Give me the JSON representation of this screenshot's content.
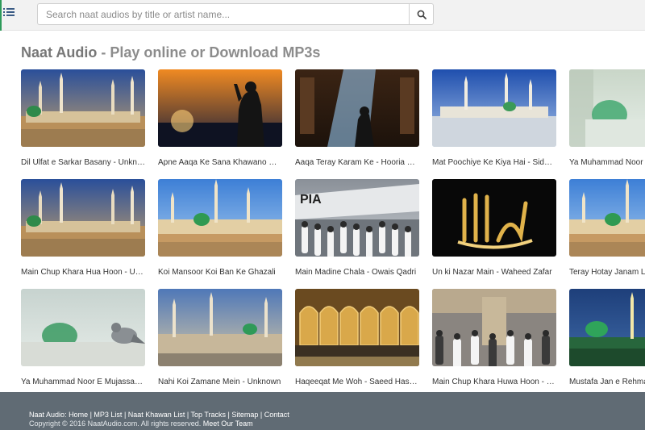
{
  "header": {
    "menu_icon": "sidebar-toggle-icon",
    "search": {
      "placeholder": "Search naat audios by title or artist name...",
      "value": ""
    },
    "search_icon": "search-icon"
  },
  "page": {
    "title_brand": "Naat Audio",
    "title_rest": " - Play online or Download MP3s"
  },
  "tracks": [
    {
      "title": "Dil Ulfat e Sarkar Basany - Unknown",
      "thumb": "mosque-madinah"
    },
    {
      "title": "Apne Aaqa Ke Sana Khawano Ki Mehfil",
      "thumb": "praying-sunset"
    },
    {
      "title": "Aaqa Teray Karam Ke - Hooria Faheem",
      "thumb": "praying-light"
    },
    {
      "title": "Mat Poochiye Ke Kiya Hai - Siddique Ismail",
      "thumb": "mosque-plaza"
    },
    {
      "title": "Ya Muhammad Noor E Mujassam",
      "thumb": "green-dome-blur"
    },
    {
      "title": "Main Chup Khara Hua Hoon - Unknown",
      "thumb": "mosque-madinah"
    },
    {
      "title": "Koi Mansoor Koi Ban Ke Ghazali",
      "thumb": "mosque-blue-sky"
    },
    {
      "title": "Main Madine Chala - Owais Qadri",
      "thumb": "pilgrims-airplane"
    },
    {
      "title": "Un ki Nazar Main - Waheed Zafar",
      "thumb": "allah-calligraphy"
    },
    {
      "title": "Teray Hotay Janam Liya",
      "thumb": "mosque-blue-sky"
    },
    {
      "title": "Ya Muhammad Noor E Mujassam - Unknown",
      "thumb": "dome-pigeon"
    },
    {
      "title": "Nahi Koi Zamane Mein - Unknown",
      "thumb": "mosque-evening"
    },
    {
      "title": "Haqeeqat Me Woh - Saeed Hashmi",
      "thumb": "mosque-interior"
    },
    {
      "title": "Main Chup Khara Huwa Hoon - Unknown",
      "thumb": "pilgrims-interior"
    },
    {
      "title": "Mustafa Jan e Rehmat",
      "thumb": "green-dome-night"
    }
  ],
  "footer": {
    "brand": "Naat Audio:",
    "links": [
      "Home",
      "MP3 List",
      "Naat Khawan List",
      "Top Tracks",
      "Sitemap",
      "Contact"
    ],
    "copyright": "Copyright © 2016 NaatAudio.com. All rights reserved.",
    "meet": "Meet Our Team"
  }
}
